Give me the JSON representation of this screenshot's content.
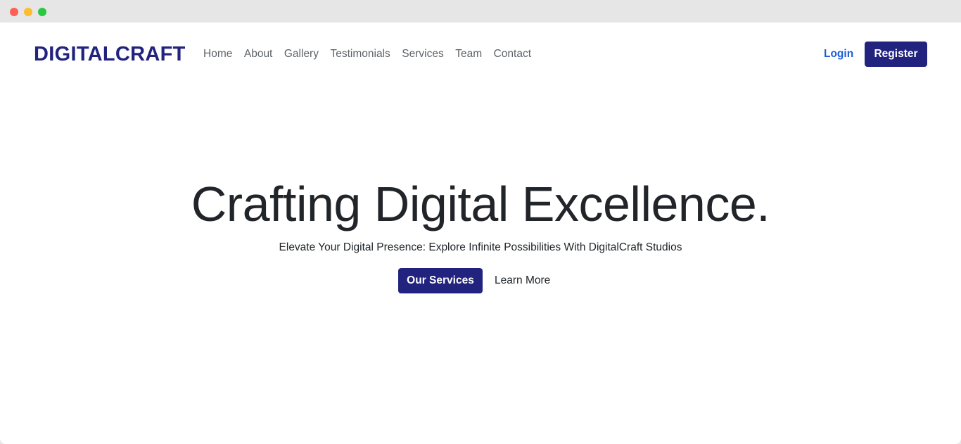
{
  "colors": {
    "brand": "#21237f",
    "accent_link": "#1a5fd6",
    "button_bg": "#21237f",
    "nav_text": "#5f6368",
    "traffic_red": "#fe5f57",
    "traffic_yellow": "#febc2e",
    "traffic_green": "#28c840"
  },
  "navbar": {
    "brand": "DIGITALCRAFT",
    "links": [
      {
        "label": "Home"
      },
      {
        "label": "About"
      },
      {
        "label": "Gallery"
      },
      {
        "label": "Testimonials"
      },
      {
        "label": "Services"
      },
      {
        "label": "Team"
      },
      {
        "label": "Contact"
      }
    ],
    "login_label": "Login",
    "register_label": "Register"
  },
  "hero": {
    "title": "Crafting Digital Excellence.",
    "subtitle": "Elevate Your Digital Presence: Explore Infinite Possibilities With DigitalCraft Studios",
    "primary_label": "Our Services",
    "secondary_label": "Learn More"
  }
}
